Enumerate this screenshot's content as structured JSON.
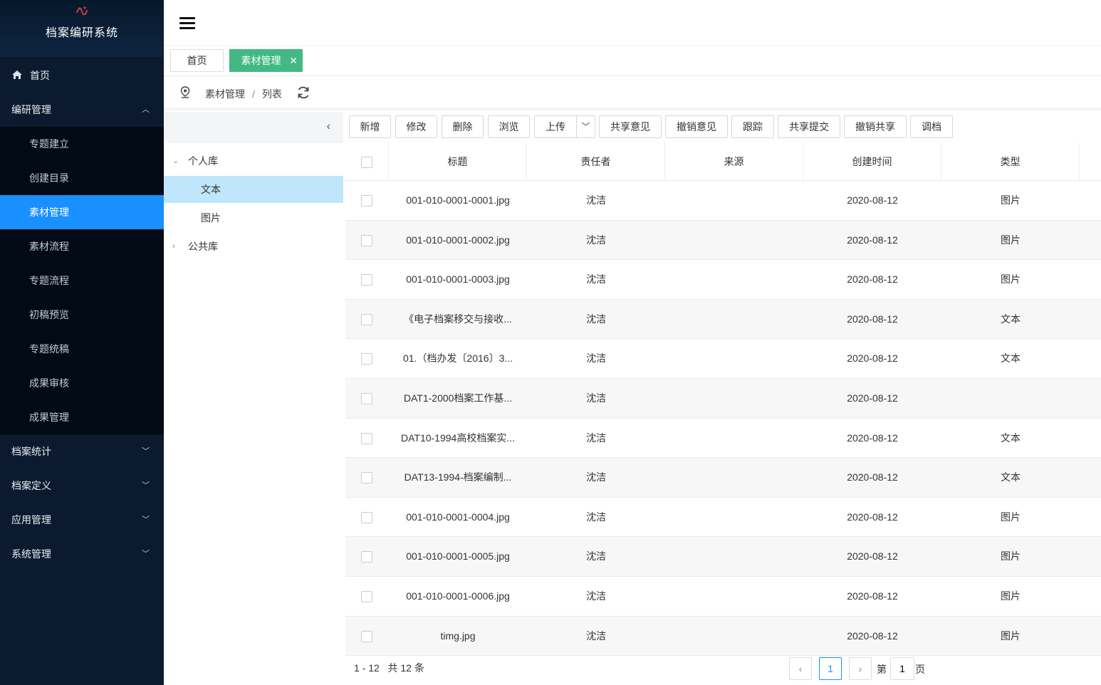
{
  "app": {
    "title": "档案编研系统"
  },
  "sidebar": {
    "home": "首页",
    "group_open": "编研管理",
    "sub_items": [
      "专题建立",
      "创建目录",
      "素材管理",
      "素材流程",
      "专题流程",
      "初稿预览",
      "专题统稿",
      "成果审核",
      "成果管理"
    ],
    "active_sub": "素材管理",
    "groups": [
      "档案统计",
      "档案定义",
      "应用管理",
      "系统管理"
    ]
  },
  "tabs": {
    "home": "首页",
    "active": "素材管理",
    "close": "✕"
  },
  "breadcrumb": {
    "section": "素材管理",
    "sep": "/",
    "page": "列表"
  },
  "tree": {
    "personal": "个人库",
    "personal_children": [
      "文本",
      "图片"
    ],
    "public": "公共库"
  },
  "toolbar": [
    "新增",
    "修改",
    "删除",
    "浏览",
    "上传",
    "共享意见",
    "撤销意见",
    "跟踪",
    "共享提交",
    "撤销共享",
    "调档"
  ],
  "table": {
    "headers": [
      "标题",
      "责任者",
      "来源",
      "创建时间",
      "类型"
    ],
    "rows": [
      {
        "title": "001-010-0001-0001.jpg",
        "owner": "沈洁",
        "source": "",
        "date": "2020-08-12",
        "type": "图片"
      },
      {
        "title": "001-010-0001-0002.jpg",
        "owner": "沈洁",
        "source": "",
        "date": "2020-08-12",
        "type": "图片"
      },
      {
        "title": "001-010-0001-0003.jpg",
        "owner": "沈洁",
        "source": "",
        "date": "2020-08-12",
        "type": "图片"
      },
      {
        "title": "《电子档案移交与接收...",
        "owner": "沈洁",
        "source": "",
        "date": "2020-08-12",
        "type": "文本"
      },
      {
        "title": "01.（档办发〔2016〕3...",
        "owner": "沈洁",
        "source": "",
        "date": "2020-08-12",
        "type": "文本"
      },
      {
        "title": "DAT1-2000档案工作基...",
        "owner": "沈洁",
        "source": "",
        "date": "2020-08-12",
        "type": ""
      },
      {
        "title": "DAT10-1994高校档案实...",
        "owner": "沈洁",
        "source": "",
        "date": "2020-08-12",
        "type": "文本"
      },
      {
        "title": "DAT13-1994-档案编制...",
        "owner": "沈洁",
        "source": "",
        "date": "2020-08-12",
        "type": "文本"
      },
      {
        "title": "001-010-0001-0004.jpg",
        "owner": "沈洁",
        "source": "",
        "date": "2020-08-12",
        "type": "图片"
      },
      {
        "title": "001-010-0001-0005.jpg",
        "owner": "沈洁",
        "source": "",
        "date": "2020-08-12",
        "type": "图片"
      },
      {
        "title": "001-010-0001-0006.jpg",
        "owner": "沈洁",
        "source": "",
        "date": "2020-08-12",
        "type": "图片"
      },
      {
        "title": "timg.jpg",
        "owner": "沈洁",
        "source": "",
        "date": "2020-08-12",
        "type": "图片"
      }
    ]
  },
  "pagination": {
    "range": "1 - 12",
    "total": "共 12 条",
    "current": "1",
    "goto_prefix": "第",
    "goto_value": "1",
    "goto_suffix": "页"
  },
  "colors": {
    "sidebar_bg": "#0b1a2e",
    "active": "#1890ff",
    "tab_active": "#42b983",
    "tree_selected": "#bfe6fb"
  }
}
